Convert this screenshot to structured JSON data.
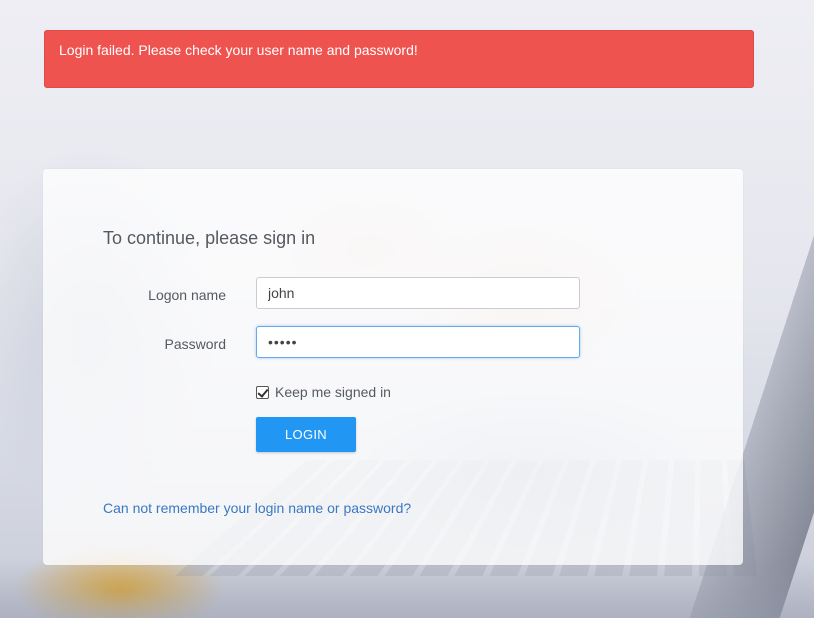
{
  "alert": {
    "message": "Login failed. Please check your user name and password!",
    "color": "#ef5350"
  },
  "signin": {
    "title": "To continue, please sign in",
    "logon_label": "Logon name",
    "logon_value": "john",
    "password_label": "Password",
    "password_value": "•••••",
    "remember_label": "Keep me signed in",
    "remember_checked": true,
    "login_button": "LOGIN",
    "forgot_link": "Can not remember your login name or password?"
  },
  "colors": {
    "accent": "#2196f3",
    "link": "#3a78c2"
  }
}
